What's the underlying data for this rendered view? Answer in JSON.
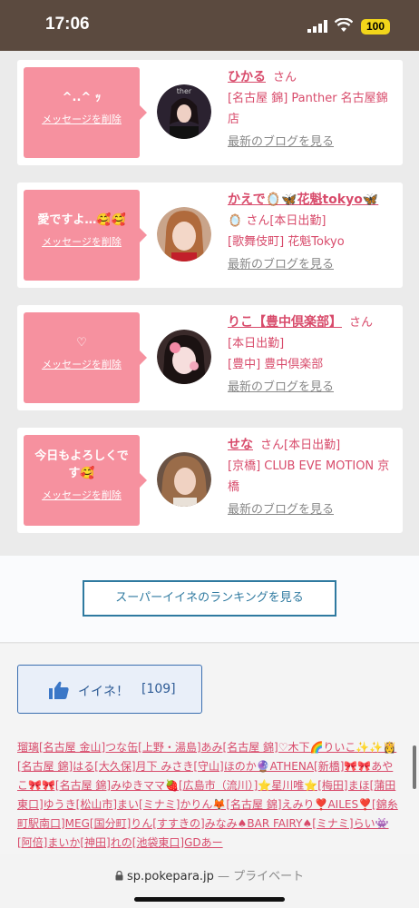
{
  "status_bar": {
    "time": "17:06",
    "battery": "100"
  },
  "cards": [
    {
      "message": "^..^ ｯ",
      "delete_label": "メッセージを削除",
      "name": "ひかる",
      "san": "さん",
      "detail": "[名古屋 錦] Panther 名古屋錦店",
      "blog": "最新のブログを見る"
    },
    {
      "message": "愛ですよ…🥰🥰",
      "delete_label": "メッセージを削除",
      "name": "かえで🪞🦋花魁tokyo🦋",
      "san": "🪞 さん[本日出勤]",
      "detail": "[歌舞伎町] 花魁Tokyo",
      "blog": "最新のブログを見る"
    },
    {
      "message": "♡",
      "delete_label": "メッセージを削除",
      "name": "りこ【豊中倶楽部】",
      "san": "さん",
      "detail": "[本日出勤]\n[豊中] 豊中倶楽部",
      "blog": "最新のブログを見る"
    },
    {
      "message": "今日もよろしくです🥰",
      "delete_label": "メッセージを削除",
      "name": "せな",
      "san": "さん[本日出勤]",
      "detail": "[京橋] CLUB EVE MOTION 京橋",
      "blog": "最新のブログを見る"
    }
  ],
  "ranking_button": "スーパーイイネのランキングを見る",
  "like_button": {
    "label": "イイネ！",
    "count": "[109]"
  },
  "likers_text": "瑠璃[名古屋 金山]つな缶[上野・湯島]あみ[名古屋 錦]♡木下🌈りいこ✨✨👸[名古屋 錦]はる[大久保]月下 みさき[守山]ほのか🔮ATHENA[新橋]🎀🎀あやこ🎀🎀[名古屋 錦]みゆきママ🍓[広島市（流川）]⭐星川唯⭐[梅田]まほ[蒲田東口]ゆうき[松山市]まい[ミナミ]かりん🦊[名古屋 錦]えみり❣️AILES❣️[錦糸町駅南口]MEG[国分町]りん[すすきの]みなみ♠BAR FAIRY♠[ミナミ]らい👾[阿倍]まいか[神田]れの[池袋東口]GDあー",
  "url_bar": {
    "host": "sp.pokepara.jp",
    "mode": "— プライベート"
  }
}
